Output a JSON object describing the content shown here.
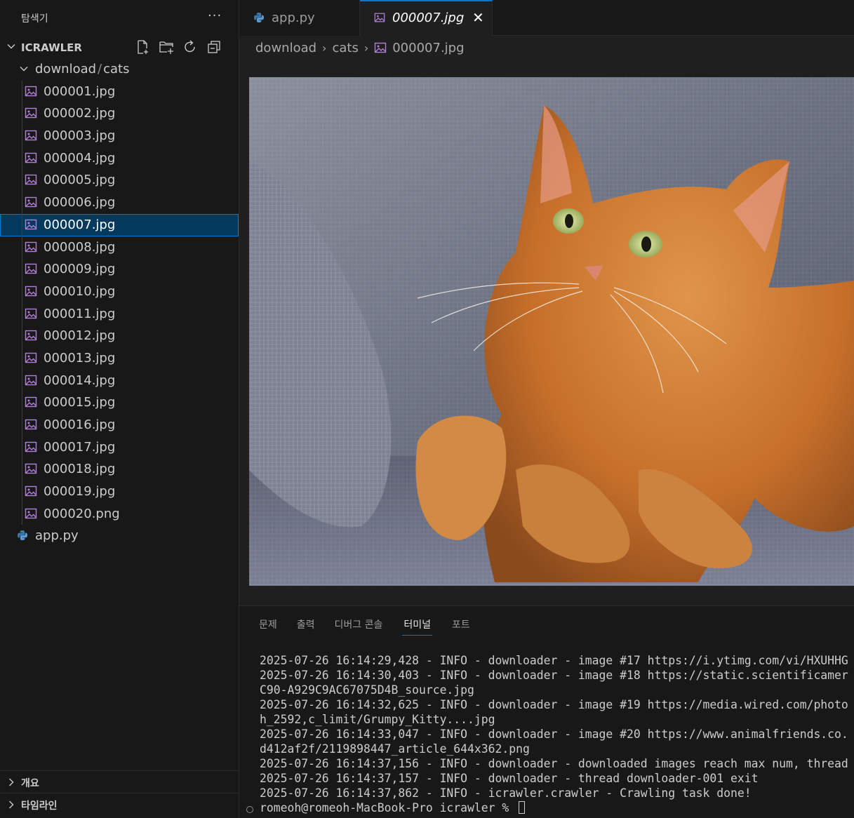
{
  "sidebar": {
    "title": "탐색기",
    "more": "···",
    "project": "ICRAWLER",
    "folder": {
      "name": "download",
      "subfolder": "cats",
      "separator": "/"
    },
    "files": [
      "000001.jpg",
      "000002.jpg",
      "000003.jpg",
      "000004.jpg",
      "000005.jpg",
      "000006.jpg",
      "000007.jpg",
      "000008.jpg",
      "000009.jpg",
      "000010.jpg",
      "000011.jpg",
      "000012.jpg",
      "000013.jpg",
      "000014.jpg",
      "000015.jpg",
      "000016.jpg",
      "000017.jpg",
      "000018.jpg",
      "000019.jpg",
      "000020.png"
    ],
    "selected_file": "000007.jpg",
    "root_file": "app.py",
    "outline_label": "개요",
    "timeline_label": "타임라인"
  },
  "tabs": [
    {
      "label": "app.py",
      "icon": "python-icon",
      "active": false
    },
    {
      "label": "000007.jpg",
      "icon": "image-icon",
      "active": true,
      "close": "✕"
    }
  ],
  "breadcrumb": {
    "parts": [
      "download",
      "cats",
      "000007.jpg"
    ]
  },
  "panel": {
    "tabs": [
      "문제",
      "출력",
      "디버그 콘솔",
      "터미널",
      "포트"
    ],
    "active_tab": "터미널",
    "terminal_lines": [
      "2025-07-26 16:14:29,428 - INFO - downloader - image #17 https://i.ytimg.com/vi/HXUHHG",
      "2025-07-26 16:14:30,403 - INFO - downloader - image #18 https://static.scientificamer",
      "C90-A929C9AC67075D4B_source.jpg",
      "2025-07-26 16:14:32,625 - INFO - downloader - image #19 https://media.wired.com/photo",
      "h_2592,c_limit/Grumpy_Kitty....jpg",
      "2025-07-26 16:14:33,047 - INFO - downloader - image #20 https://www.animalfriends.co.",
      "d412af2f/2119898447_article_644x362.png",
      "2025-07-26 16:14:37,156 - INFO - downloader - downloaded images reach max num, thread",
      "2025-07-26 16:14:37,157 - INFO - downloader - thread downloader-001 exit",
      "2025-07-26 16:14:37,862 - INFO - icrawler.crawler - Crawling task done!"
    ],
    "prompt": "romeoh@romeoh-MacBook-Pro icrawler % "
  },
  "colors": {
    "accent": "#0078d4",
    "selection": "#04395e",
    "image_icon": "#b180d7",
    "python_icon": "#3c78aa"
  }
}
